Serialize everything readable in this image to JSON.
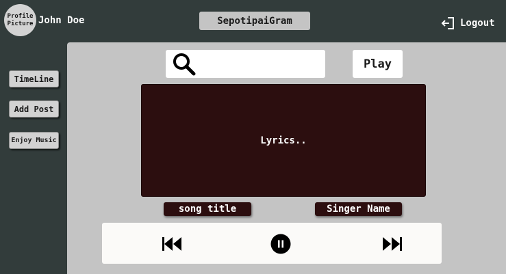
{
  "header": {
    "avatar_label": "Profile Picture",
    "username": "John Doe",
    "app_title": "SepotipaiGram",
    "logout_label": "Logout"
  },
  "sidebar": {
    "items": [
      {
        "label": "TimeLine"
      },
      {
        "label": "Add Post"
      },
      {
        "label": "Enjoy Music"
      }
    ]
  },
  "player": {
    "search": {
      "placeholder": "",
      "value": ""
    },
    "play_label": "Play",
    "lyrics": "Lyrics..",
    "song_title": "song title",
    "singer_name": "Singer Name"
  },
  "icons": {
    "search": "search-icon",
    "logout": "logout-icon",
    "previous": "skip-previous-icon",
    "pause": "pause-icon",
    "next": "skip-next-icon"
  },
  "colors": {
    "background": "#323c3b",
    "panel": "#c4c4c4",
    "accent_dark": "#2c0e0f",
    "button_light": "#d2d2d2"
  }
}
